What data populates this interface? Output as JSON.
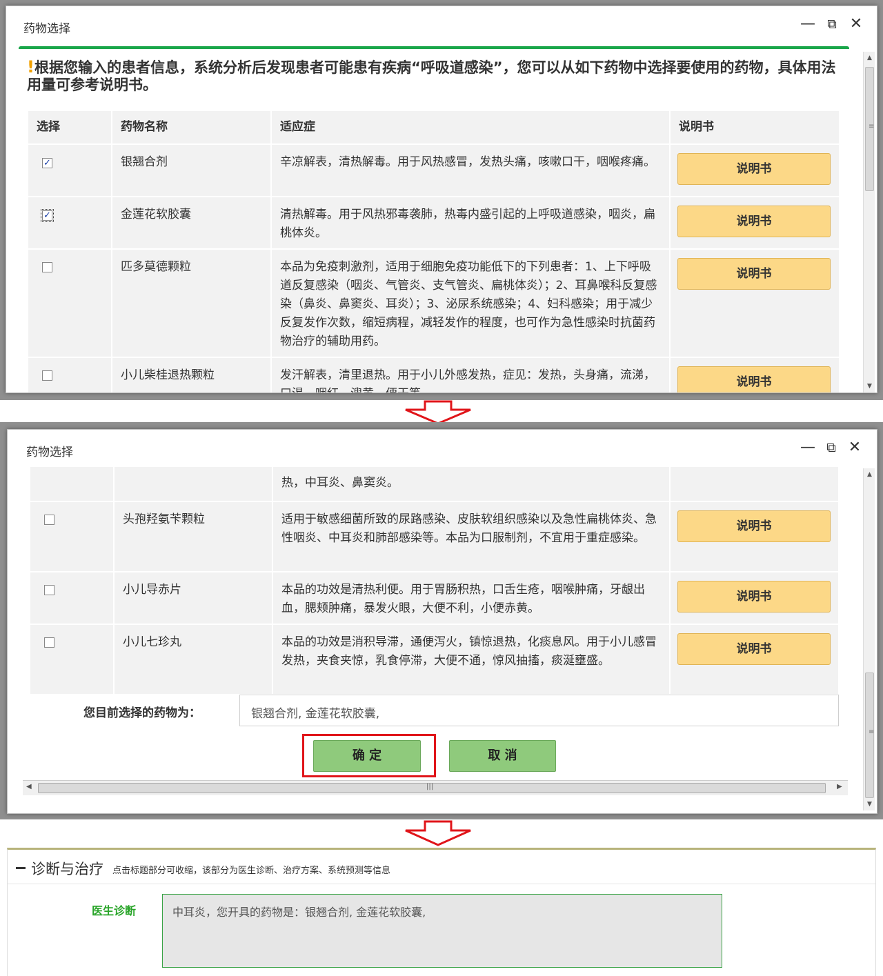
{
  "dialog": {
    "title": "药物选择",
    "notice": "根据您输入的患者信息，系统分析后发现患者可能患有疾病“呼吸道感染”，您可以从如下药物中选择要使用的药物，具体用法用量可参考说明书。",
    "notice_mark": "!",
    "columns": [
      "选择",
      "药物名称",
      "适应症",
      "说明书"
    ],
    "manual_label": "说明书",
    "rows_top": [
      {
        "checked": true,
        "name": "银翘合剂",
        "indication": "辛凉解表，清热解毒。用于风热感冒，发热头痛，咳嗽口干，咽喉疼痛。"
      },
      {
        "checked": true,
        "name": "金莲花软胶囊",
        "indication": "清热解毒。用于风热邪毒袭肺，热毒内盛引起的上呼吸道感染，咽炎，扁桃体炎。"
      },
      {
        "checked": false,
        "name": "匹多莫德颗粒",
        "indication": "本品为免疫刺激剂，适用于细胞免疫功能低下的下列患者：1、上下呼吸道反复感染（咽炎、气管炎、支气管炎、扁桃体炎）；2、耳鼻喉科反复感染（鼻炎、鼻窦炎、耳炎）；3、泌尿系统感染；4、妇科感染；用于减少反复发作次数，缩短病程，减轻发作的程度，也可作为急性感染时抗菌药物治疗的辅助用药。"
      },
      {
        "checked": false,
        "name": "小儿柴桂退热颗粒",
        "indication": "发汗解表，清里退热。用于小儿外感发热，症见：发热，头身痛，流涕，口渴，咽红，溲黄，便干等。"
      }
    ],
    "rows_bottom_partial": "热，中耳炎、鼻窦炎。",
    "rows_bottom": [
      {
        "checked": false,
        "name": "头孢羟氨苄颗粒",
        "indication": "适用于敏感细菌所致的尿路感染、皮肤软组织感染以及急性扁桃体炎、急性咽炎、中耳炎和肺部感染等。本品为口服制剂，不宜用于重症感染。"
      },
      {
        "checked": false,
        "name": "小儿导赤片",
        "indication": "本品的功效是清热利便。用于胃肠积热，口舌生疮，咽喉肿痛，牙龈出血，腮颊肿痛，暴发火眼，大便不利，小便赤黄。"
      },
      {
        "checked": false,
        "name": "小儿七珍丸",
        "indication": "本品的功效是消积导滞，通便泻火，镇惊退热，化痰息风。用于小儿感冒发热，夹食夹惊，乳食停滞，大便不通，惊风抽搐，痰涎壅盛。"
      }
    ],
    "selected_label": "您目前选择的药物为：",
    "selected_value": "银翘合剂, 金莲花软胶囊,",
    "ok_label": "确 定",
    "cancel_label": "取 消"
  },
  "section": {
    "title": "诊断与治疗",
    "subtitle": "点击标题部分可收缩，该部分为医生诊断、治疗方案、系统预测等信息",
    "diagnosis_label": "医生诊断",
    "diagnosis_value": "中耳炎，您开具的药物是：银翘合剂, 金莲花软胶囊,"
  },
  "colors": {
    "manual_button": "#fcd887",
    "ok_button": "#8fca7c",
    "highlight": "#e0151a",
    "header_line": "#1aa64a"
  }
}
